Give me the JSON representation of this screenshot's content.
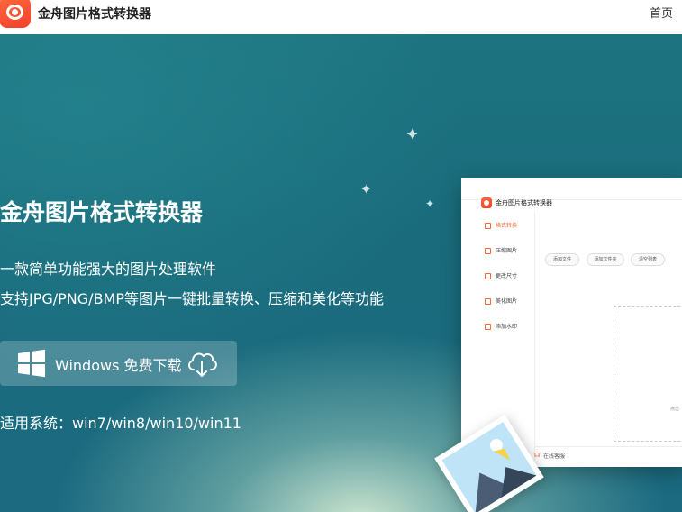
{
  "header": {
    "app_title": "金舟图片格式转换器",
    "logo_icon": "jinzhou-logo-icon",
    "nav_home": "首页"
  },
  "hero": {
    "title": "金舟图片格式转换器",
    "subtitle_1": "一款简单功能强大的图片处理软件",
    "subtitle_2": "支持JPG/PNG/BMP等图片一键批量转换、压缩和美化等功能",
    "download_button": "Windows 免费下载",
    "download_icon": "cloud-download-icon",
    "windows_icon": "windows-logo-icon",
    "system_requirements": "适用系统：win7/win8/win10/win11"
  },
  "preview": {
    "title": "金舟图片格式转换器",
    "sidebar": [
      {
        "label": "格式转换",
        "active": true
      },
      {
        "label": "压缩图片",
        "active": false
      },
      {
        "label": "更改尺寸",
        "active": false
      },
      {
        "label": "美化图片",
        "active": false
      },
      {
        "label": "添加水印",
        "active": false
      }
    ],
    "toolbar": [
      "添加文件",
      "添加文件夹",
      "清空列表"
    ],
    "drop_hint": "点击",
    "support": "在线客服"
  },
  "colors": {
    "accent": "#f06a3a",
    "hero_bg": "#1b6f80",
    "glow": "#d6ecd4"
  }
}
